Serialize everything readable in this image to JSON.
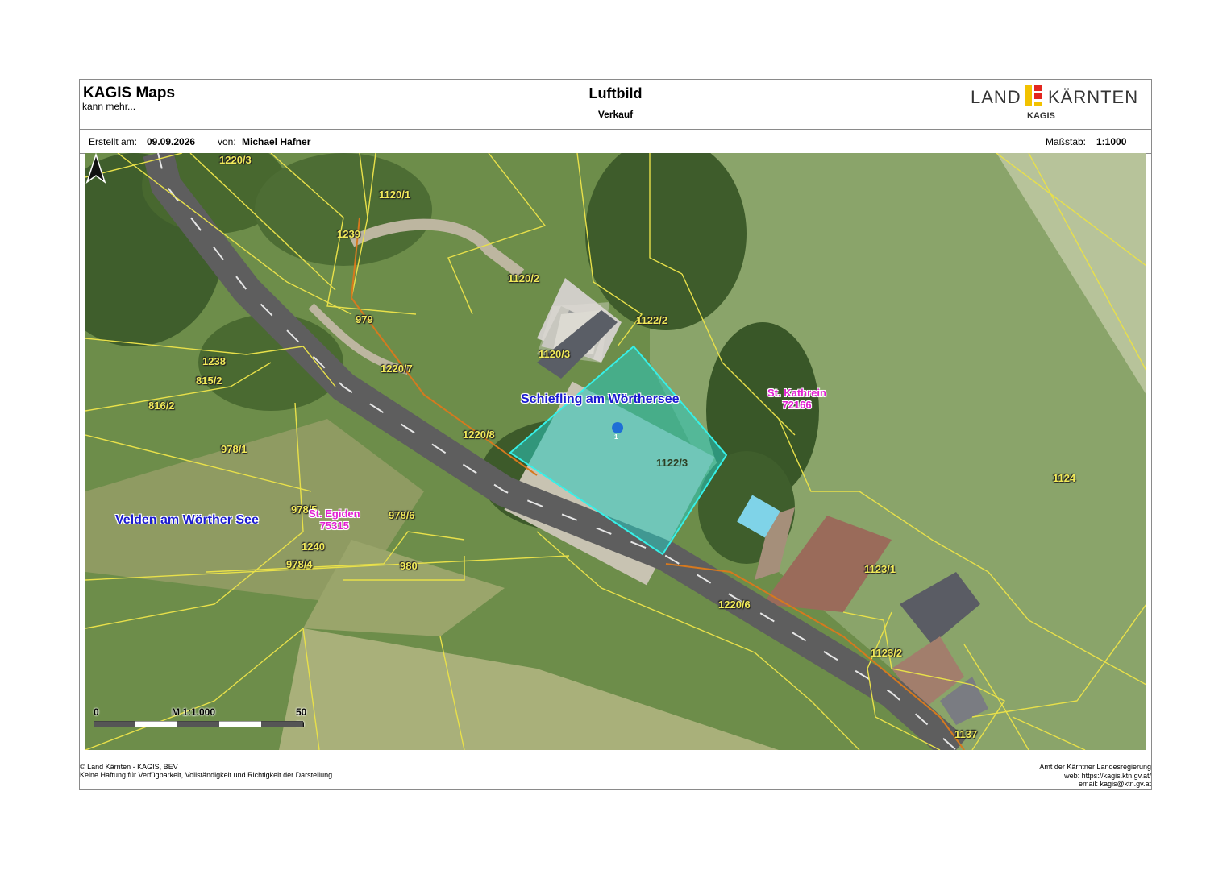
{
  "header": {
    "brand": "KAGIS Maps",
    "brand_sub": "kann mehr...",
    "title": "Luftbild",
    "subtitle": "Verkauf",
    "logo": {
      "left": "LAND",
      "right": "KÄRNTEN",
      "sub": "KAGIS",
      "colors": [
        "#f2c200",
        "#e3261f"
      ]
    }
  },
  "meta": {
    "created_label": "Erstellt am:",
    "created_value": "09.09.2026",
    "by_label": "von:",
    "by_value": "Michael Hafner",
    "scale_label": "Maßstab:",
    "scale_value": "1:1000"
  },
  "map": {
    "parcels": [
      "1220/3",
      "1120/1",
      "1239",
      "1120/2",
      "979",
      "1122/2",
      "1120/3",
      "1238",
      "815/2",
      "1220/7",
      "816/2",
      "1220/8",
      "978/1",
      "1122/3",
      "1124",
      "978/5",
      "978/6",
      "1240",
      "978/4",
      "980",
      "1123/1",
      "1220/6",
      "1123/2",
      "1137"
    ],
    "places": [
      "Schiefling am Wörthersee",
      "Velden am Wörther See"
    ],
    "cadastral": [
      {
        "name": "St. Kathrein",
        "code": "72166"
      },
      {
        "name": "St. Egiden",
        "code": "75315"
      }
    ],
    "marker": "1",
    "scalebar": {
      "start": "0",
      "label": "M 1:1.000",
      "end": "50 m"
    },
    "colors": {
      "parcel_line": "#e8e04a",
      "highlight": "#2fe0d8",
      "road": "#5d5d5d"
    }
  },
  "footer": {
    "left": [
      "© Land Kärnten - KAGIS, BEV",
      "Keine Haftung für Verfügbarkeit, Vollständigkeit und Richtigkeit der Darstellung."
    ],
    "right": [
      "Amt der Kärntner Landesregierung",
      "web: https://kagis.ktn.gv.at/",
      "email: kagis@ktn.gv.at"
    ]
  }
}
